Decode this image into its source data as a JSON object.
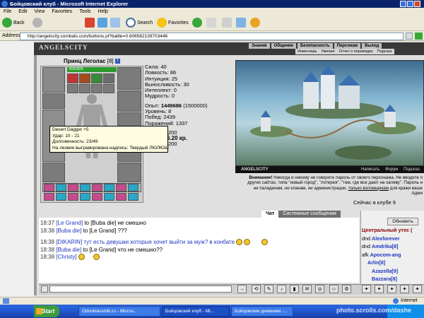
{
  "window": {
    "title": "Бойцовский клуб - Microsoft Internet Explorer"
  },
  "menu": [
    "File",
    "Edit",
    "View",
    "Favorites",
    "Tools",
    "Help"
  ],
  "toolbar": {
    "back": "Back",
    "search": "Search",
    "favorites": "Favorites"
  },
  "address": {
    "label": "Address",
    "url": "http://angelscity.combats.com/buttons.pl?battle=0.606562139703446"
  },
  "game": {
    "logo": "ANGELSCITY",
    "nav": [
      "Знания",
      "Общение",
      "Безопасность",
      "Персонаж",
      "Выход"
    ],
    "subnav": [
      "Инвентарь",
      "Умения",
      "Отчет о переводах",
      "Подсказ"
    ],
    "picture_bar": [
      "ANGELSCITY",
      "Написать",
      "Форум",
      "Подсказ"
    ]
  },
  "character": {
    "name": "Принц Леголас",
    "level": "[8]",
    "info_icon": "i",
    "hp": "825/825",
    "stats": [
      {
        "label": "Сила:",
        "value": "40"
      },
      {
        "label": "Ловкость:",
        "value": "86"
      },
      {
        "label": "Интуиция:",
        "value": "25"
      },
      {
        "label": "Выносливость:",
        "value": "30"
      },
      {
        "label": "Интеллект:",
        "value": "0"
      },
      {
        "label": "Мудрость:",
        "value": "0"
      }
    ],
    "exp_label": "Опыт:",
    "exp_value": "1449686",
    "exp_next": "(1500000)",
    "level_label": "Уровень:",
    "level_value": "8",
    "wins_label": "Побед:",
    "wins_value": "2439",
    "losses_label": "Поражений:",
    "losses_value": "1337",
    "extra1": "200",
    "money": "6.20 кр.",
    "extra2": "200"
  },
  "tooltip": {
    "lines": [
      "Desert Dagger +5",
      "Удар: 10 - 21",
      "Долговечность: 23/49",
      "На лезвии выгравирована надпись: Твердый ЛЮЛЮШ"
    ]
  },
  "notice": {
    "lead": "Внимание!",
    "text1": "Никогда и никому не говорите пароль от своего персонажа. Не вводите п",
    "text2": "других сайтах, типа \"новый город\", \"лотерея\", \"там, где все дают на халяву\". Пароль н",
    "text3": "ни паладинам, ни кланам, ни администрации,",
    "link": "только взломщикам",
    "text4": "для кражи ваше",
    "text5": "Адми",
    "online": "Сейчас в клубе 9"
  },
  "chat": {
    "tab_active": "Чат",
    "tab_system": "Системные сообщения",
    "lines": [
      {
        "time": "18:37",
        "nick": "[Le Grand]",
        "to": "to [Buba die]",
        "msg": "не смешно"
      },
      {
        "time": "18:38",
        "nick": "[Buba die]",
        "to": "to [Le Grand]",
        "msg": "???"
      },
      {
        "time": "18:38",
        "nick": "[DIKARIN]",
        "to": "",
        "msg": "тут есть девушки которые хочет выйти за муж? в конбате"
      },
      {
        "time": "18:38",
        "nick": "[Buba die]",
        "to": "to [Le Grand]",
        "msg": "что не смешно??"
      },
      {
        "time": "18:38",
        "nick": "[Christy]",
        "to": "",
        "msg": ""
      }
    ]
  },
  "right_panel": {
    "refresh": "Обновить",
    "heading": "Центральный утес (",
    "users": [
      {
        "prefix": "dnd",
        "name": "Alexforever"
      },
      {
        "prefix": "dnd",
        "name": "Amdrika[8]"
      },
      {
        "prefix": "afk",
        "name": "Apocom-ang"
      },
      {
        "prefix": "",
        "name": "Arlin[8]"
      },
      {
        "prefix": "",
        "name": "Azazella[9]"
      },
      {
        "prefix": "",
        "name": "Bazzara[8]"
      }
    ]
  },
  "status": {
    "zone": "Internet"
  },
  "taskbar": {
    "start": "Start",
    "tasks": [
      "Odnoklassniki.ru - Micros...",
      "Бойцовский клуб - Mi...",
      "Бойцовские дневники -..."
    ]
  },
  "watermark": "photo.scrolls.com/dashe"
}
